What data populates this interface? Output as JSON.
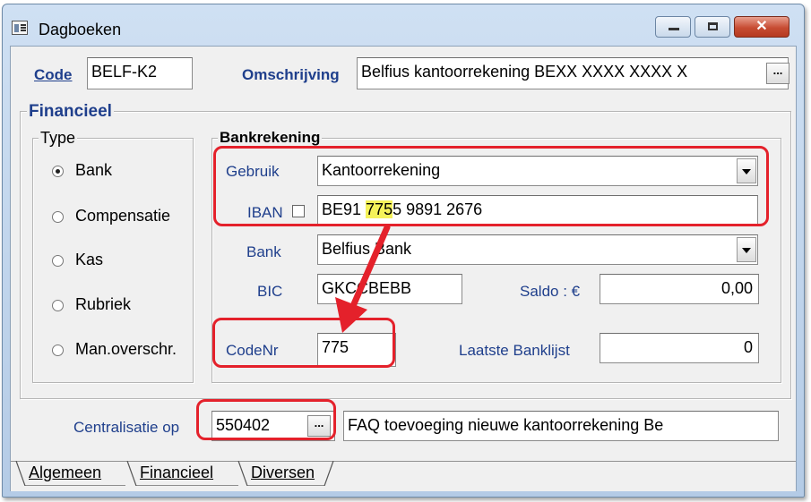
{
  "window": {
    "title": "Dagboeken",
    "close_glyph": "✕"
  },
  "header": {
    "code_label": "Code",
    "code_value": "BELF-K2",
    "omschrijving_label": "Omschrijving",
    "omschrijving_value": "Belfius kantoorrekening BEXX XXXX XXXX X",
    "ellipsis": "..."
  },
  "financieel": {
    "group_title": "Financieel",
    "type": {
      "title": "Type",
      "options": [
        {
          "label": "Bank",
          "selected": true
        },
        {
          "label": "Compensatie",
          "selected": false
        },
        {
          "label": "Kas",
          "selected": false
        },
        {
          "label": "Rubriek",
          "selected": false
        },
        {
          "label": "Man.overschr.",
          "selected": false
        }
      ]
    },
    "bankrekening": {
      "title": "Bankrekening",
      "gebruik_label": "Gebruik",
      "gebruik_value": "Kantoorrekening",
      "iban_label": "IBAN",
      "iban_checked": false,
      "iban_prefix": "BE91 ",
      "iban_highlight": "775",
      "iban_suffix": "5 9891 2676",
      "bank_label": "Bank",
      "bank_value": "Belfius Bank",
      "bic_label": "BIC",
      "bic_value": "GKCCBEBB",
      "saldo_label": "Saldo : €",
      "saldo_value": "0,00",
      "codenr_label": "CodeNr",
      "codenr_value": "775",
      "laatste_label": "Laatste Banklijst",
      "laatste_value": "0"
    },
    "centralisatie": {
      "label": "Centralisatie op",
      "value": "550402",
      "ellipsis": "...",
      "description": "FAQ toevoeging nieuwe kantoorrekening Be"
    }
  },
  "tabs": [
    {
      "label": "Algemeen",
      "active": false
    },
    {
      "label": "Financieel",
      "active": true
    },
    {
      "label": "Diversen",
      "active": false
    }
  ],
  "colors": {
    "annotation_red": "#e4212b",
    "highlight_yellow": "#f5f25a",
    "label_blue": "#1f3f8c"
  }
}
